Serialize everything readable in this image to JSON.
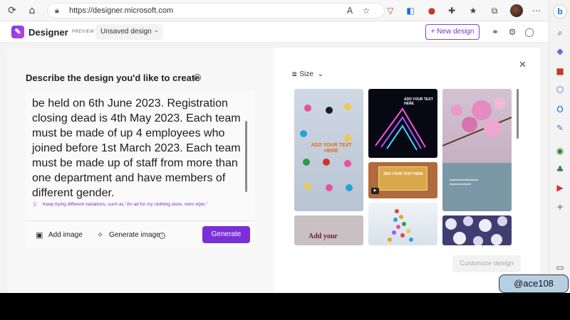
{
  "browser": {
    "url": "https://designer.microsoft.com"
  },
  "header": {
    "app_name": "Designer",
    "preview_tag": "PREVIEW",
    "doc_name": "Unsaved design",
    "new_design_label": "+ New design"
  },
  "prompt": {
    "title": "Describe the design you'd like to create",
    "text": "be held on 6th June 2023. Registration closing dead is 4th May 2023. Each team must be made of up 4 employees who joined before 1st March 2023. Each team must be made up of staff from more than one department and have members of different gender.",
    "hint": "Keep trying different variations, such as \"An ad for my clothing store, retro style.\""
  },
  "actions": {
    "add_image": "Add image",
    "generate_image": "Generate image",
    "generate": "Generate"
  },
  "gallery": {
    "size_label": "Size",
    "tiles": {
      "t1_text": "ADD YOUR TEXT HERE",
      "t2_text": "ADD YOUR TEXT HERE",
      "t3_text": "ADD YOUR TEXT HERE",
      "t5_text": "Add your"
    },
    "customize_label": "Customize design"
  },
  "watermark": "@ace108",
  "colors": {
    "accent": "#7b2fd6",
    "background": "#f3f3f3"
  }
}
